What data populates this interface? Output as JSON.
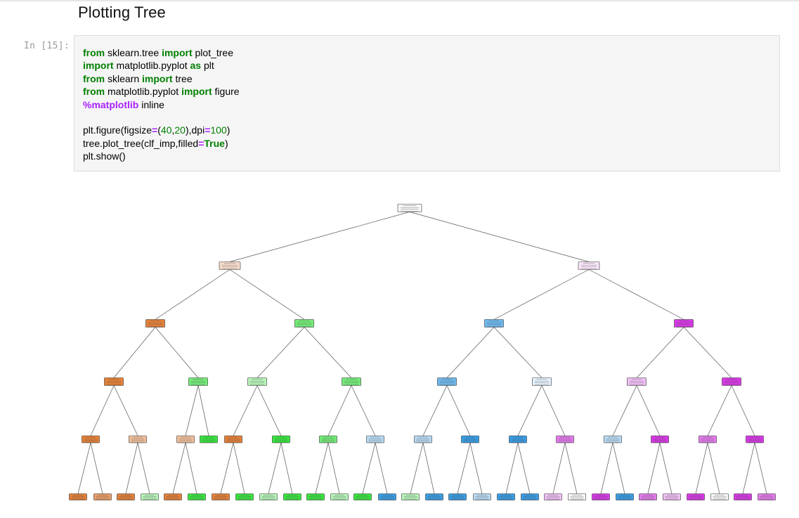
{
  "notebook": {
    "heading": "Plotting Tree",
    "cell": {
      "prompt": "In [15]:",
      "code_lines": [
        [
          {
            "t": "from",
            "c": "kw"
          },
          {
            "t": " sklearn.tree ",
            "c": ""
          },
          {
            "t": "import",
            "c": "kw"
          },
          {
            "t": " plot_tree",
            "c": ""
          }
        ],
        [
          {
            "t": "import",
            "c": "kw"
          },
          {
            "t": " matplotlib.pyplot ",
            "c": ""
          },
          {
            "t": "as",
            "c": "kw"
          },
          {
            "t": " plt",
            "c": ""
          }
        ],
        [
          {
            "t": "from",
            "c": "kw"
          },
          {
            "t": " sklearn ",
            "c": ""
          },
          {
            "t": "import",
            "c": "kw"
          },
          {
            "t": " tree",
            "c": ""
          }
        ],
        [
          {
            "t": "from",
            "c": "kw"
          },
          {
            "t": " matplotlib.pyplot ",
            "c": ""
          },
          {
            "t": "import",
            "c": "kw"
          },
          {
            "t": " figure",
            "c": ""
          }
        ],
        [
          {
            "t": "%matplotlib",
            "c": "mg"
          },
          {
            "t": " inline",
            "c": ""
          }
        ],
        [],
        [
          {
            "t": "plt.figure(figsize",
            "c": ""
          },
          {
            "t": "=",
            "c": "op"
          },
          {
            "t": "(",
            "c": ""
          },
          {
            "t": "40",
            "c": "num"
          },
          {
            "t": ",",
            "c": ""
          },
          {
            "t": "20",
            "c": "num"
          },
          {
            "t": "),dpi",
            "c": ""
          },
          {
            "t": "=",
            "c": "op"
          },
          {
            "t": "100",
            "c": "num"
          },
          {
            "t": ")",
            "c": ""
          }
        ],
        [
          {
            "t": "tree.plot_tree(clf_imp,filled",
            "c": ""
          },
          {
            "t": "=",
            "c": "op"
          },
          {
            "t": "True",
            "c": "bi"
          },
          {
            "t": ")",
            "c": ""
          }
        ],
        [
          {
            "t": "plt.show()",
            "c": ""
          }
        ]
      ]
    },
    "tree_plot": {
      "node_colors": {
        "white": "#f7f7f7",
        "orange_light": "#f5dccb",
        "orange": "#e58139",
        "orange_mid": "#eb9e66",
        "orange_pale": "#f2c09c",
        "green": "#39e53f",
        "green_mid": "#74eb78",
        "green_light": "#b7f4b9",
        "blue": "#399de5",
        "blue_mid": "#6fb8ec",
        "blue_light": "#b9dbf4",
        "blue_pale": "#e5f1fb",
        "magenta": "#d739e5",
        "magenta_mid": "#e37bec",
        "magenta_light": "#f0c0f4",
        "magenta_pale": "#f9e6fb"
      },
      "levels": [
        [
          "white"
        ],
        [
          "orange_light",
          "magenta_pale"
        ],
        [
          "orange",
          "green_mid",
          "blue_mid",
          "magenta"
        ],
        [
          "orange",
          "green_mid",
          "green_light",
          "green_mid",
          "blue_mid",
          "blue_pale",
          "magenta_light",
          "magenta"
        ],
        [
          "orange",
          "orange_pale",
          "orange_pale",
          "green",
          "orange",
          "green",
          "green_mid",
          "blue_light",
          "blue_light",
          "blue",
          "blue",
          "magenta_mid",
          "blue_light",
          "magenta",
          "magenta_mid",
          "magenta"
        ],
        [
          "orange",
          "orange_mid",
          "orange",
          "green_light",
          "orange",
          "green",
          "orange",
          "green",
          "green_light",
          "green",
          "green",
          "green_light",
          "green",
          "blue",
          "green_light",
          "blue",
          "blue",
          "blue_light",
          "blue",
          "blue",
          "magenta_light",
          "white",
          "magenta",
          "blue",
          "magenta_mid",
          "magenta_light",
          "magenta",
          "white",
          "magenta",
          "magenta_mid",
          "magenta"
        ]
      ]
    }
  }
}
